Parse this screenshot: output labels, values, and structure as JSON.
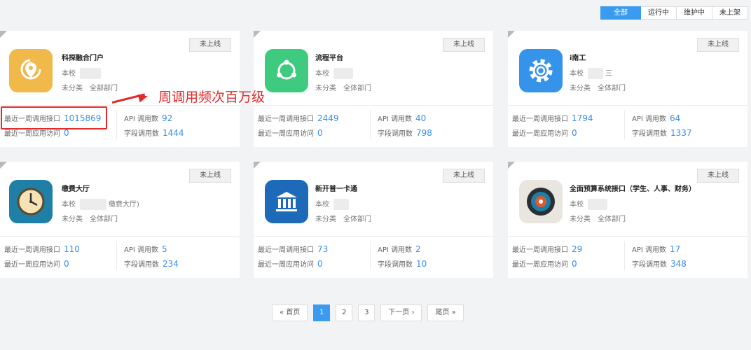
{
  "filters": [
    "全部",
    "运行中",
    "维护中",
    "未上架"
  ],
  "cards": [
    {
      "title": "科探融合门户",
      "school": "本校",
      "category": "未分类",
      "dept": "全部部门",
      "status": "未上线",
      "weekly_api_label": "最近一周调用接口",
      "weekly_api": "1015869",
      "weekly_visit_label": "最近一周应用访问",
      "weekly_visit": "0",
      "api_count_label": "API 调用数",
      "api_count": "92",
      "field_count_label": "字段调用数",
      "field_count": "1444"
    },
    {
      "title": "流程平台",
      "school": "本校",
      "category": "未分类",
      "dept": "全体部门",
      "status": "未上线",
      "weekly_api_label": "最近一周调用接口",
      "weekly_api": "2449",
      "weekly_visit_label": "最近一周应用访问",
      "weekly_visit": "0",
      "api_count_label": "API 调用数",
      "api_count": "40",
      "field_count_label": "字段调用数",
      "field_count": "798"
    },
    {
      "title": "i南工",
      "school": "本校",
      "school_suffix": "三",
      "category": "未分类",
      "dept": "全体部门",
      "status": "未上线",
      "weekly_api_label": "最近一周调用接口",
      "weekly_api": "1794",
      "weekly_visit_label": "最近一周应用访问",
      "weekly_visit": "0",
      "api_count_label": "API 调用数",
      "api_count": "64",
      "field_count_label": "字段调用数",
      "field_count": "1337"
    },
    {
      "title": "缴费大厅",
      "school": "本校",
      "school_suffix": "缴费大厅)",
      "category": "未分类",
      "dept": "全体部门",
      "status": "未上线",
      "weekly_api_label": "最近一周调用接口",
      "weekly_api": "110",
      "weekly_visit_label": "最近一周应用访问",
      "weekly_visit": "0",
      "api_count_label": "API 调用数",
      "api_count": "5",
      "field_count_label": "字段调用数",
      "field_count": "234"
    },
    {
      "title": "新开普一卡通",
      "school": "本校",
      "category": "未分类",
      "dept": "全体部门",
      "status": "未上线",
      "weekly_api_label": "最近一周调用接口",
      "weekly_api": "73",
      "weekly_visit_label": "最近一周应用访问",
      "weekly_visit": "0",
      "api_count_label": "API 调用数",
      "api_count": "2",
      "field_count_label": "字段调用数",
      "field_count": "10"
    },
    {
      "title": "全面预算系统接口（学生、人事、财务）",
      "school": "本校",
      "category": "未分类",
      "dept": "全体部门",
      "status": "未上线",
      "weekly_api_label": "最近一周调用接口",
      "weekly_api": "29",
      "weekly_visit_label": "最近一周应用访问",
      "weekly_visit": "0",
      "api_count_label": "API 调用数",
      "api_count": "17",
      "field_count_label": "字段调用数",
      "field_count": "348"
    }
  ],
  "annotation": "周调用频次百万级",
  "pagination": {
    "first": "« 首页",
    "pages": [
      "1",
      "2",
      "3"
    ],
    "next": "下一页 ›",
    "last": "尾页 »"
  },
  "colors": {
    "accent": "#3a9bef",
    "value": "#3a8ee6",
    "annotation": "#e22b2b"
  }
}
